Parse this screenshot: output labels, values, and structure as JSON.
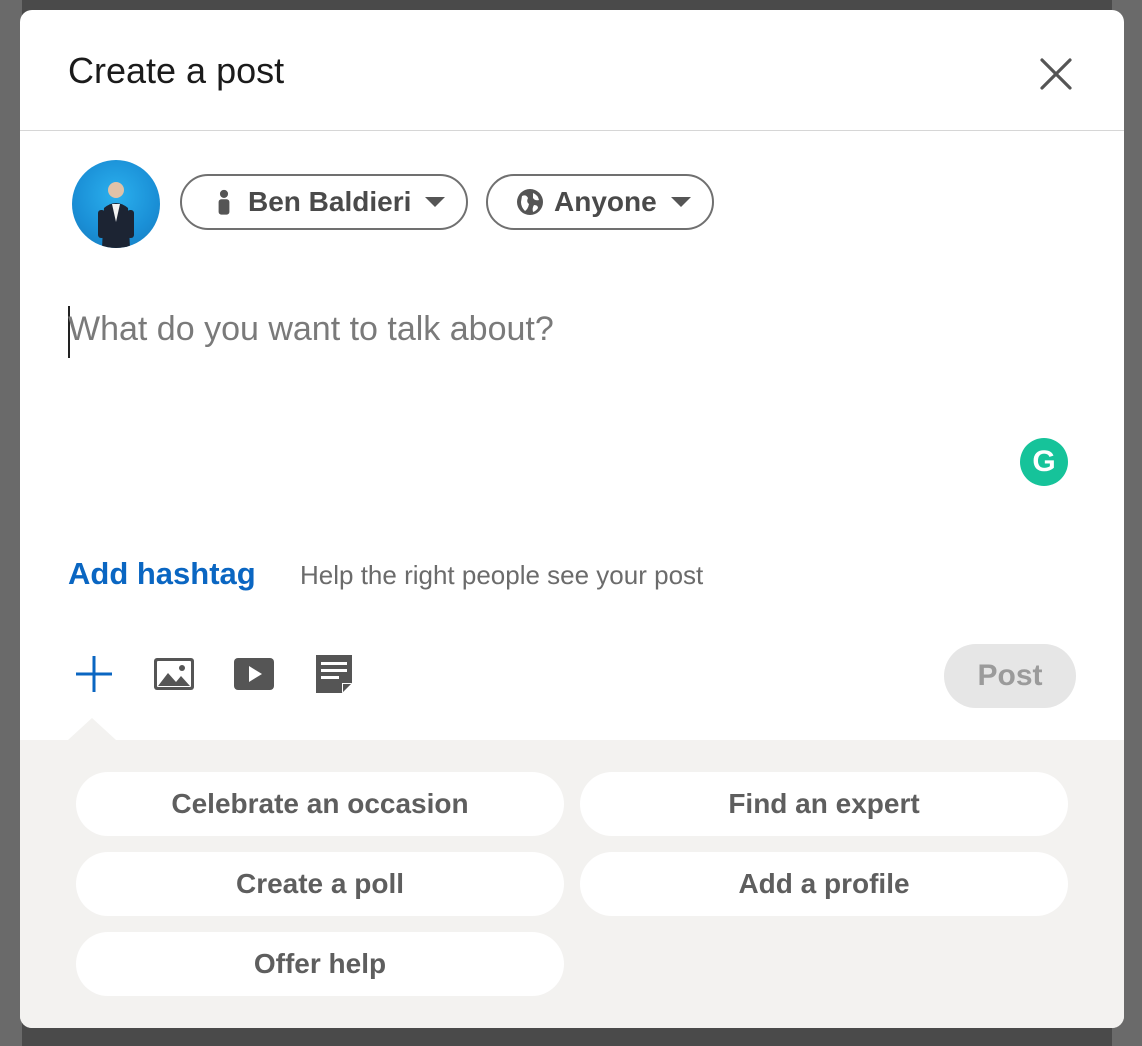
{
  "modal": {
    "title": "Create a post",
    "close_icon": "close-icon"
  },
  "author": {
    "name": "Ben Baldieri",
    "name_icon": "person-icon",
    "visibility": "Anyone",
    "visibility_icon": "globe-icon"
  },
  "editor": {
    "placeholder": "What do you want to talk about?",
    "value": ""
  },
  "hashtag": {
    "link": "Add hashtag",
    "help": "Help the right people see your post"
  },
  "toolbar": {
    "icons": [
      "plus-icon",
      "photo-icon",
      "video-icon",
      "document-icon"
    ],
    "post_label": "Post",
    "accent_color": "#0a66c2",
    "post_disabled": true
  },
  "more_options": [
    "Celebrate an occasion",
    "Find an expert",
    "Create a poll",
    "Add a profile",
    "Offer help"
  ]
}
